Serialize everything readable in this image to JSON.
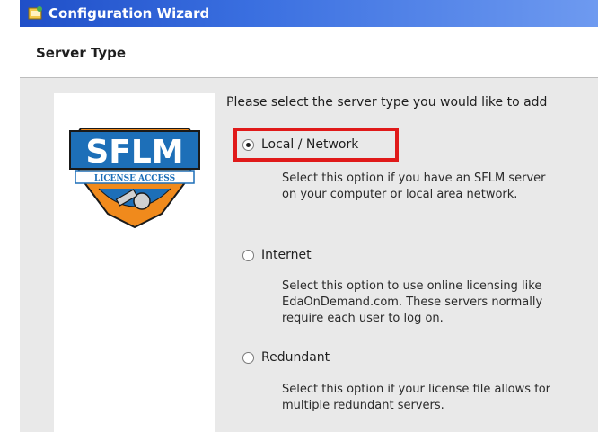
{
  "window": {
    "title": "Configuration Wizard"
  },
  "header": {
    "title": "Server Type"
  },
  "logo": {
    "text": "SFLM",
    "banner": "LICENSE ACCESS"
  },
  "content": {
    "prompt": "Please select the server type you would like to add",
    "options": [
      {
        "label": "Local / Network",
        "checked": true,
        "description": "Select this option if you have an SFLM server on your computer or local area network."
      },
      {
        "label": "Internet",
        "checked": false,
        "description": "Select this option to use online licensing like EdaOnDemand.com. These servers normally require each user to log on."
      },
      {
        "label": "Redundant",
        "checked": false,
        "description": "Select this option if your license file allows for multiple redundant servers."
      }
    ]
  },
  "colors": {
    "title_bar": "#1f4fc8",
    "logo_blue": "#1d6fb8",
    "logo_orange": "#f08a1c",
    "highlight": "#e01a1a"
  }
}
